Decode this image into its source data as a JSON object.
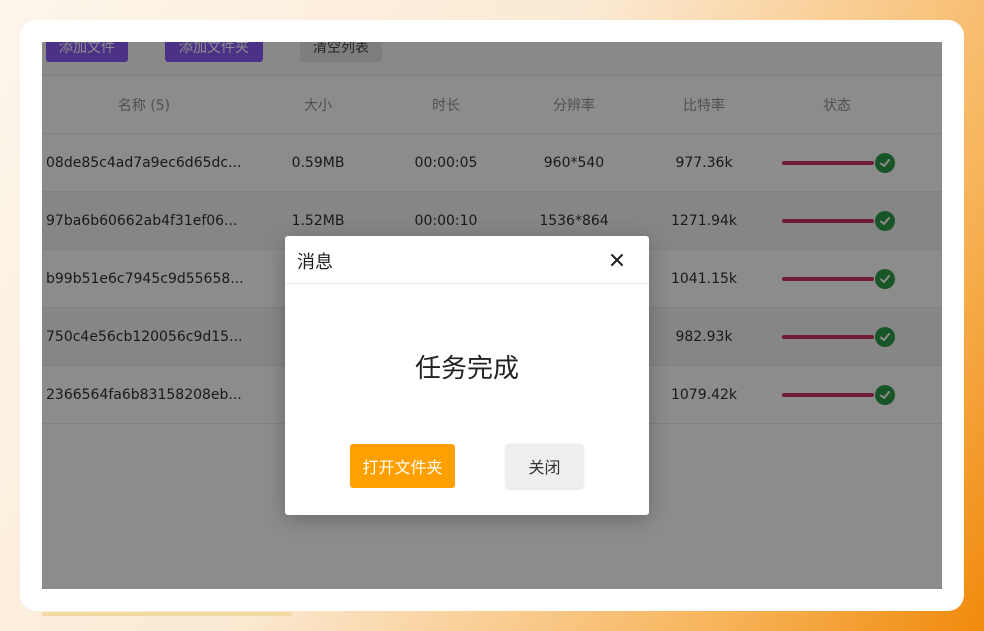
{
  "colors": {
    "button_purple": "#8B5CF6",
    "progress": "#C9325F",
    "success": "#2E9D48",
    "warning": "#FF9F00"
  },
  "toolbar": {
    "add_file": "添加文件",
    "add_folder": "添加文件夹",
    "clear_list": "清空列表"
  },
  "table": {
    "headers": {
      "name": "名称 (5)",
      "size": "大小",
      "duration": "时长",
      "resolution": "分辨率",
      "bitrate": "比特率",
      "status": "状态"
    },
    "rows": [
      {
        "name": "08de85c4ad7a9ec6d65dc...",
        "size": "0.59MB",
        "duration": "00:00:05",
        "resolution": "960*540",
        "bitrate": "977.36k",
        "progress": 1.0,
        "status_icon": "check-circle-icon"
      },
      {
        "name": "97ba6b60662ab4f31ef06...",
        "size": "1.52MB",
        "duration": "00:00:10",
        "resolution": "1536*864",
        "bitrate": "1271.94k",
        "progress": 1.0,
        "status_icon": "check-circle-icon"
      },
      {
        "name": "b99b51e6c7945c9d55658...",
        "size": "",
        "duration": "",
        "resolution": "",
        "bitrate": "1041.15k",
        "progress": 1.0,
        "status_icon": "check-circle-icon"
      },
      {
        "name": "750c4e56cb120056c9d15...",
        "size": "",
        "duration": "",
        "resolution": "",
        "bitrate": "982.93k",
        "progress": 1.0,
        "status_icon": "check-circle-icon"
      },
      {
        "name": "2366564fa6b83158208eb...",
        "size": "",
        "duration": "",
        "resolution": "",
        "bitrate": "1079.42k",
        "progress": 1.0,
        "status_icon": "check-circle-icon"
      }
    ]
  },
  "dialog": {
    "title": "消息",
    "close_icon": "close-icon",
    "message": "任务完成",
    "open_folder": "打开文件夹",
    "close": "关闭"
  }
}
